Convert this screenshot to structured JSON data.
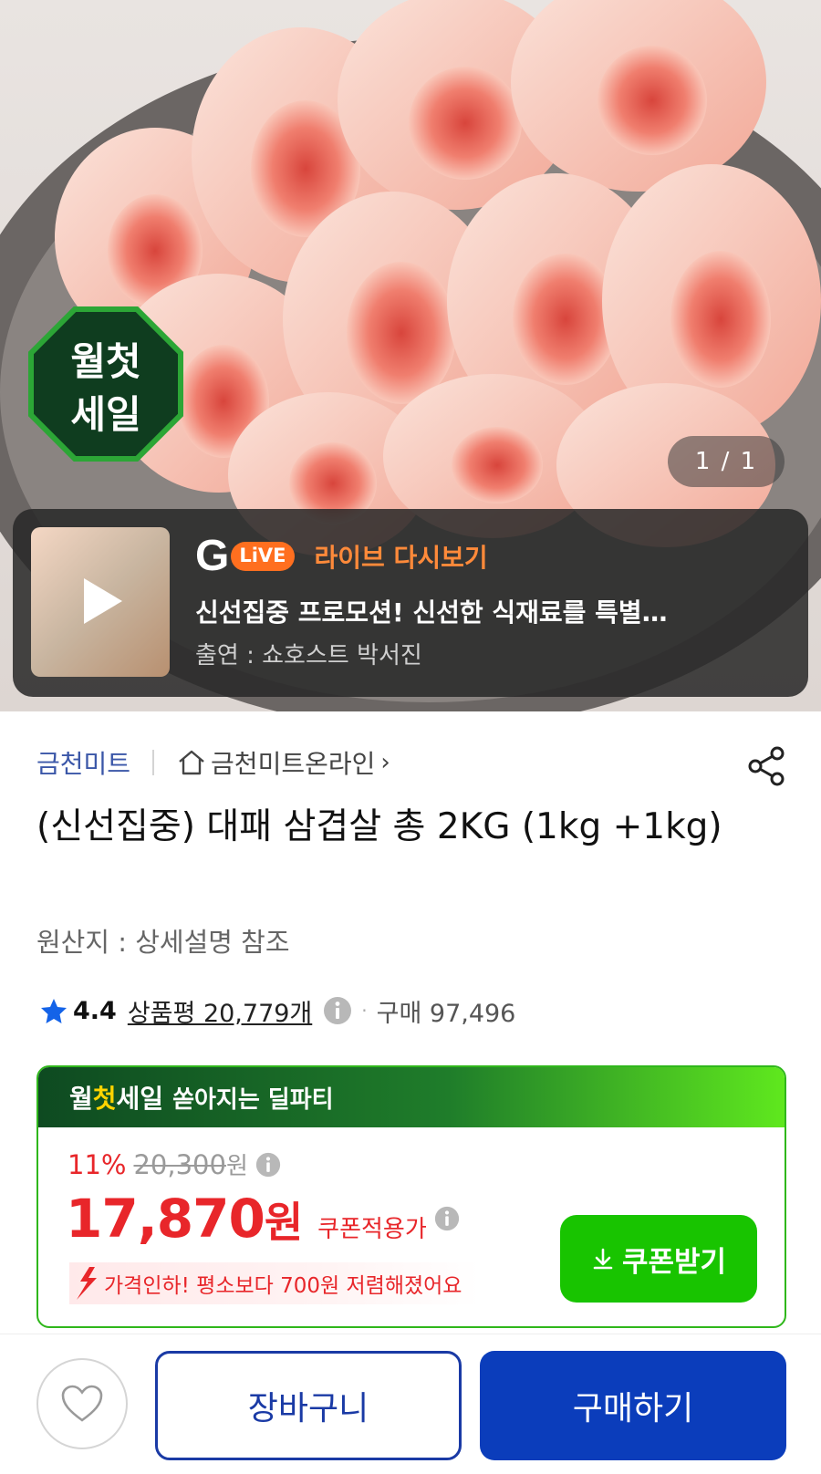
{
  "hero": {
    "image_alt": "rolled pork belly slices",
    "sale_badge": {
      "line1": "월첫",
      "line2": "세일"
    },
    "counter": "1 / 1"
  },
  "live": {
    "logo_g": "G",
    "logo_live": "LiVE",
    "replay_label": "라이브 다시보기",
    "title": "신선집중 프로모션! 신선한 식재료를 특별…",
    "host": "출연 : 쇼호스트 박서진"
  },
  "store": {
    "name": "금천미트",
    "online_store": "금천미트온라인",
    "chevron": "›"
  },
  "product": {
    "title": "(신선집중) 대패 삼겹살 총 2KG (1kg +1kg)",
    "origin": "원산지 : 상세설명 참조"
  },
  "rating": {
    "score": "4.4",
    "reviews": "상품평 20,779개",
    "separator": "·",
    "purchases": "구매 97,496"
  },
  "deal": {
    "brand_a": "월",
    "brand_b": "첫",
    "brand_c": "세일",
    "subtitle": "쏟아지는 딜파티",
    "discount_pct": "11%",
    "original_price": "20,300",
    "original_won": "원",
    "price": "17,870",
    "price_won": "원",
    "coupon_applied": "쿠폰적용가",
    "price_drop": "가격인하! 평소보다 700원 저렴해졌어요",
    "coupon_button": "쿠폰받기"
  },
  "bottom": {
    "cart": "장바구니",
    "buy": "구매하기"
  },
  "colors": {
    "accent_red": "#e8262a",
    "store_blue": "#3b57a8",
    "buy_blue": "#0b3dbb",
    "coupon_green": "#18c400",
    "live_orange": "#ff6f1f"
  }
}
